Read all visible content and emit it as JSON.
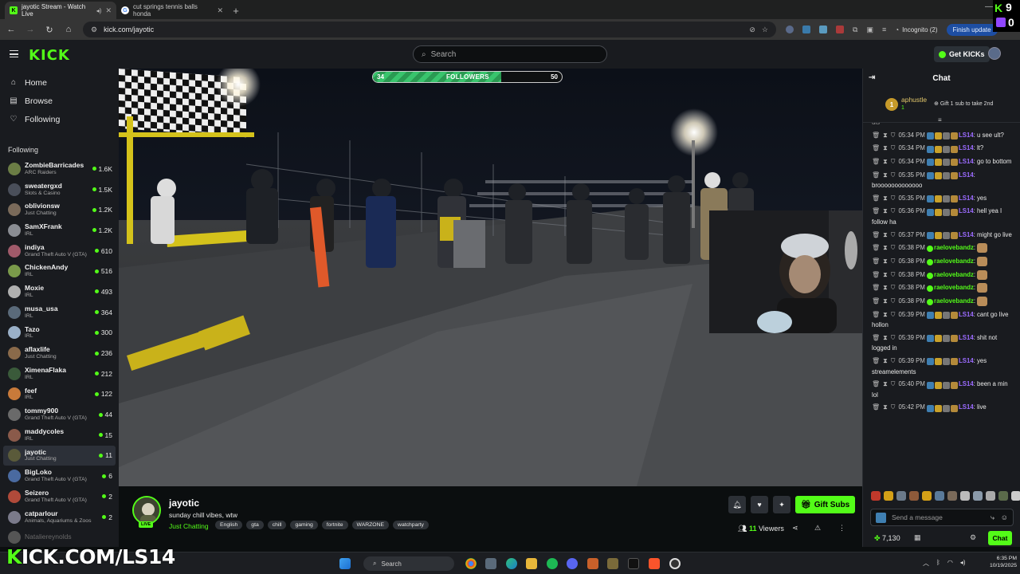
{
  "browser": {
    "tabs": [
      {
        "title": "jayotic Stream - Watch Live",
        "active": true
      },
      {
        "title": "cut springs tennis balls honda",
        "active": false
      }
    ],
    "new_tab": "+",
    "url": "kick.com/jayotic",
    "incognito_label": "Incognito (2)",
    "finish_update_label": "Finish update"
  },
  "header": {
    "logo": "KICK",
    "search_placeholder": "Search",
    "get_kicks_label": "Get KICKs"
  },
  "sidebar": {
    "nav": [
      {
        "label": "Home",
        "icon": "home-icon"
      },
      {
        "label": "Browse",
        "icon": "browse-icon"
      },
      {
        "label": "Following",
        "icon": "heart-icon"
      }
    ],
    "following_heading": "Following",
    "channels": [
      {
        "name": "ZombieBarricades",
        "category": "ARC Raiders",
        "viewers": "1.6K",
        "color": "#6b7d45"
      },
      {
        "name": "sweatergxd",
        "category": "Slots & Casino",
        "viewers": "1.5K",
        "color": "#4a4f5a"
      },
      {
        "name": "oblivionsw",
        "category": "Just Chatting",
        "viewers": "1.2K",
        "color": "#7a6a5a"
      },
      {
        "name": "SamXFrank",
        "category": "IRL",
        "viewers": "1.2K",
        "color": "#8a8d93"
      },
      {
        "name": "indiya",
        "category": "Grand Theft Auto V (GTA)",
        "viewers": "610",
        "color": "#a05a6a"
      },
      {
        "name": "ChickenAndy",
        "category": "IRL",
        "viewers": "516",
        "color": "#7a9a4a"
      },
      {
        "name": "Moxie",
        "category": "IRL",
        "viewers": "493",
        "color": "#b0b0b0"
      },
      {
        "name": "musa_usa",
        "category": "IRL",
        "viewers": "364",
        "color": "#5a6a7a"
      },
      {
        "name": "Tazo",
        "category": "IRL",
        "viewers": "300",
        "color": "#9ab0c8"
      },
      {
        "name": "aflaxlife",
        "category": "Just Chatting",
        "viewers": "236",
        "color": "#8a6a4a"
      },
      {
        "name": "XimenaFlaka",
        "category": "IRL",
        "viewers": "212",
        "color": "#3a5a3a"
      },
      {
        "name": "feef",
        "category": "IRL",
        "viewers": "122",
        "color": "#c87a3a"
      },
      {
        "name": "tommy900",
        "category": "Grand Theft Auto V (GTA)",
        "viewers": "44",
        "color": "#6a6a6a"
      },
      {
        "name": "maddycoles",
        "category": "IRL",
        "viewers": "15",
        "color": "#8a5a4a"
      },
      {
        "name": "jayotic",
        "category": "Just Chatting",
        "viewers": "11",
        "color": "#5a5a3a",
        "active": true
      },
      {
        "name": "BigLoko",
        "category": "Grand Theft Auto V (GTA)",
        "viewers": "6",
        "color": "#4a6aa0"
      },
      {
        "name": "Seizero",
        "category": "Grand Theft Auto V (GTA)",
        "viewers": "2",
        "color": "#b04a3a"
      },
      {
        "name": "catparlour",
        "category": "Animals, Aquariums & Zoos",
        "viewers": "2",
        "color": "#7a7a8a"
      },
      {
        "name": "Nataliereynolds",
        "category": "",
        "viewers": "",
        "color": "#555555",
        "offline": true
      }
    ]
  },
  "video": {
    "followers_current": "34",
    "followers_label": "FOLLOWERS",
    "followers_goal": "50",
    "progress_fraction": 0.68
  },
  "stream": {
    "name": "jayotic",
    "live_badge": "LIVE",
    "title": "sunday chill vibes, wtw",
    "category": "Just Chatting",
    "tags": [
      "English",
      "gta",
      "chill",
      "gaming",
      "fortnite",
      "WARZONE",
      "watchparty"
    ],
    "gift_subs_label": "Gift Subs",
    "viewers_count": "11",
    "viewers_label": "Viewers"
  },
  "chat": {
    "title": "Chat",
    "pinned": {
      "rank": "1",
      "user": "aphustle",
      "amount": "1",
      "gift_text": "Gift 1 sub to take 2nd"
    },
    "truncated_top": "uis",
    "messages": [
      {
        "time": "05:34 PM",
        "user": "LS14",
        "text": "u see ult?",
        "type": "ls"
      },
      {
        "time": "05:34 PM",
        "user": "LS14",
        "text": "lt?",
        "type": "ls"
      },
      {
        "time": "05:34 PM",
        "user": "LS14",
        "text": "go to bottom",
        "type": "ls"
      },
      {
        "time": "05:35 PM",
        "user": "LS14",
        "text": "brooooooooooooo",
        "type": "ls"
      },
      {
        "time": "05:35 PM",
        "user": "LS14",
        "text": "yes",
        "type": "ls"
      },
      {
        "time": "05:36 PM",
        "user": "LS14",
        "text": "hell yea I follow ha",
        "type": "ls"
      },
      {
        "time": "05:37 PM",
        "user": "LS14",
        "text": "might go live",
        "type": "ls"
      },
      {
        "time": "05:38 PM",
        "user": "raelovebandz",
        "text": "",
        "type": "rae"
      },
      {
        "time": "05:38 PM",
        "user": "raelovebandz",
        "text": "",
        "type": "rae"
      },
      {
        "time": "05:38 PM",
        "user": "raelovebandz",
        "text": "",
        "type": "rae"
      },
      {
        "time": "05:38 PM",
        "user": "raelovebandz",
        "text": "",
        "type": "rae"
      },
      {
        "time": "05:38 PM",
        "user": "raelovebandz",
        "text": "",
        "type": "rae"
      },
      {
        "time": "05:39 PM",
        "user": "LS14",
        "text": "cant go live hollon",
        "type": "ls"
      },
      {
        "time": "05:39 PM",
        "user": "LS14",
        "text": "shit not logged in",
        "type": "ls"
      },
      {
        "time": "05:39 PM",
        "user": "LS14",
        "text": "yes streamelements",
        "type": "ls"
      },
      {
        "time": "05:40 PM",
        "user": "LS14",
        "text": "been a min lol",
        "type": "ls"
      },
      {
        "time": "05:42 PM",
        "user": "LS14",
        "text": "live",
        "type": "ls"
      }
    ],
    "input_placeholder": "Send a message",
    "kicks_balance": "7,130",
    "chat_button": "Chat"
  },
  "watermark": {
    "prefix": "K",
    "rest": "ICK.COM/LS14"
  },
  "kick_badge": {
    "count1": "9",
    "count2": "0"
  },
  "taskbar": {
    "search_placeholder": "Search",
    "time": "6:35 PM",
    "date": "10/19/2025"
  }
}
